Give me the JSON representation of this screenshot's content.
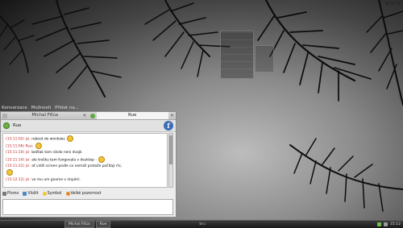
{
  "menu_bar": {
    "items": [
      "Konverzace",
      "Možnosti",
      "Přidat na..."
    ]
  },
  "desktop_widget": {
    "title": "",
    "items": [
      "",
      "",
      "",
      "",
      "",
      ""
    ]
  },
  "chat_window": {
    "tabs": [
      "Michal Fiťúa",
      "Rue"
    ],
    "contact": {
      "name": "Rue",
      "status_color": "#6db045"
    },
    "messages": [
      {
        "time": "(15:11:02)",
        "nick": "jsi:",
        "text": "reboot do windows",
        "smiley": true
      },
      {
        "time": "(15:11:06)",
        "nick": "Rue:",
        "text": "",
        "smiley": true
      },
      {
        "time": "(15:11:10)",
        "nick": "jsi:",
        "text": "bežtak tam nikdo neni dvajk",
        "smiley": false
      },
      {
        "time": "(15:11:14)",
        "nick": "jsi:",
        "text": "ale trošku tam fungovala v desktop -",
        "smiley": true
      },
      {
        "time": "(15:11:22)",
        "nick": "jsi:",
        "text": "ať vidíš screen podle co nemáš protože počítají rtc,",
        "smiley": false
      },
      {
        "time": "",
        "nick": "",
        "text": "",
        "smiley": true
      },
      {
        "time": "(15:12:12)",
        "nick": "jsi:",
        "text": "ve mu um gnome v impérii.",
        "smiley": false
      }
    ],
    "toolbar": {
      "font_label": "Písmo",
      "insert_label": "Vložit",
      "smiley_label": "Symbol",
      "attention_label": "Velké pozornost"
    }
  },
  "taskbar": {
    "tasks": [
      "Michal Fiťúa",
      "Rue"
    ],
    "middle": "bru",
    "clock": "15:12"
  },
  "colors": {
    "nick_color": "#c02a2a",
    "online_green": "#6db045",
    "fedora_blue": "#3c6eb4"
  }
}
